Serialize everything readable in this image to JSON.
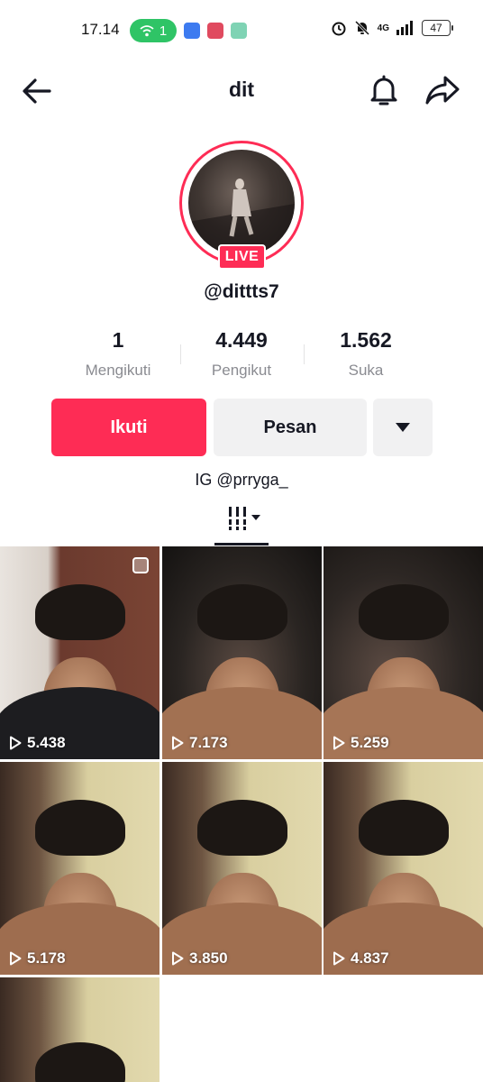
{
  "status_bar": {
    "time": "17.14",
    "hotspot_count": "1",
    "network": "4G",
    "battery": "47"
  },
  "header": {
    "title": "dit",
    "back_icon": "arrow-left-icon",
    "bell_icon": "bell-icon",
    "share_icon": "share-arrow-icon"
  },
  "profile": {
    "live_label": "LIVE",
    "username": "@dittts7",
    "bio": "IG @prryga_"
  },
  "stats": [
    {
      "value": "1",
      "label": "Mengikuti"
    },
    {
      "value": "4.449",
      "label": "Pengikut"
    },
    {
      "value": "1.562",
      "label": "Suka"
    }
  ],
  "actions": {
    "follow_label": "Ikuti",
    "message_label": "Pesan",
    "more_icon": "caret-down-icon"
  },
  "colors": {
    "accent": "#fe2c55",
    "secondary_button": "#f1f1f2",
    "muted_text": "#8a8b91"
  },
  "videos": [
    {
      "views": "5.438"
    },
    {
      "views": "7.173"
    },
    {
      "views": "5.259"
    },
    {
      "views": "5.178"
    },
    {
      "views": "3.850"
    },
    {
      "views": "4.837"
    },
    {
      "views": ""
    }
  ]
}
